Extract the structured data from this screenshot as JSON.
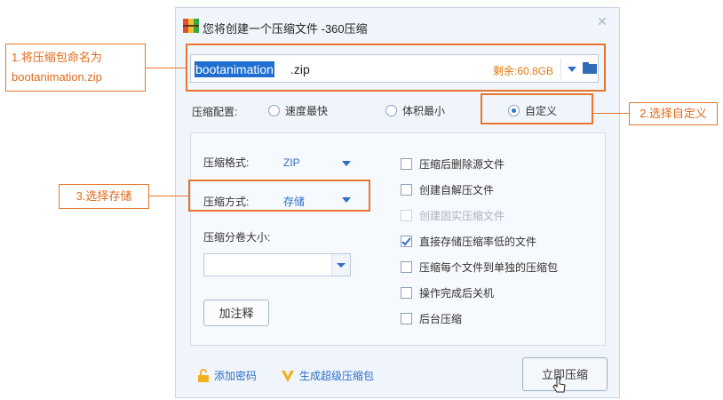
{
  "window": {
    "title": "您将创建一个压缩文件 -360压缩",
    "close_icon": "close-icon"
  },
  "filename": {
    "selected": "bootanimation",
    "extension": ".zip",
    "free_space": "剩余:60.8GB"
  },
  "config": {
    "label": "压缩配置:",
    "options": [
      "速度最快",
      "体积最小",
      "自定义"
    ],
    "selected_index": 2
  },
  "settings": {
    "format_label": "压缩格式:",
    "format_value": "ZIP",
    "method_label": "压缩方式:",
    "method_value": "存储",
    "split_label": "压缩分卷大小:",
    "split_value": "",
    "note_button": "加注释"
  },
  "options": [
    {
      "label": "压缩后删除源文件",
      "checked": false,
      "disabled": false
    },
    {
      "label": "创建自解压文件",
      "checked": false,
      "disabled": false
    },
    {
      "label": "创建固实压缩文件",
      "checked": false,
      "disabled": true
    },
    {
      "label": "直接存储压缩率低的文件",
      "checked": true,
      "disabled": false
    },
    {
      "label": "压缩每个文件到单独的压缩包",
      "checked": false,
      "disabled": false
    },
    {
      "label": "操作完成后关机",
      "checked": false,
      "disabled": false
    },
    {
      "label": "后台压缩",
      "checked": false,
      "disabled": false
    }
  ],
  "bottom": {
    "add_password": "添加密码",
    "super_compress": "生成超级压缩包",
    "compress_button": "立即压缩"
  },
  "annotations": {
    "step1_line1": "1.将压缩包命名为",
    "step1_line2": "bootanimation.zip",
    "step2": "2.选择自定义",
    "step3": "3.选择存储"
  },
  "colors": {
    "annotation": "#e8752b",
    "accent": "#2d6dc8",
    "free_space": "#e07b12",
    "selection": "#1f6fd1"
  }
}
